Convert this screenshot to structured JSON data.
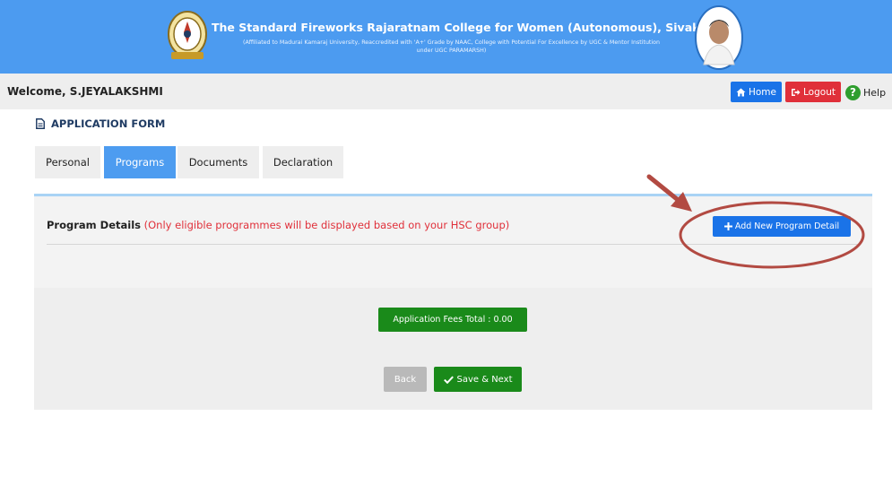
{
  "header": {
    "college_name": "The Standard Fireworks Rajaratnam College for Women (Autonomous), Sivakasi",
    "affiliation": "(Affiliated to Madurai Kamaraj University, Reaccredited with 'A+' Grade by NAAC, College with Potential For Excellence by UGC & Mentor Institution under UGC PARAMARSH)",
    "logo_icon": "college-emblem-icon",
    "portrait_icon": "founder-portrait"
  },
  "topbar": {
    "welcome": "Welcome, S.JEYALAKSHMI",
    "home_label": "Home",
    "logout_label": "Logout",
    "help_label": "Help",
    "home_icon": "home-icon",
    "logout_icon": "sign-out-icon",
    "help_icon": "question-circle-icon",
    "colors": {
      "home": "#1a73e8",
      "logout": "#e0303a",
      "help": "#2e9e2e"
    }
  },
  "form": {
    "heading": "APPLICATION FORM",
    "tabs": [
      {
        "label": "Personal",
        "active": false
      },
      {
        "label": "Programs",
        "active": true
      },
      {
        "label": "Documents",
        "active": false
      },
      {
        "label": "Declaration",
        "active": false
      }
    ],
    "program_details": {
      "title": "Program Details",
      "note": "(Only eligible programmes will be displayed based on your HSC group)",
      "add_button": "Add New Program Detail"
    },
    "fees_total": "Application Fees Total : 0.00",
    "back_label": "Back",
    "save_label": "Save & Next"
  },
  "colors": {
    "banner": "#4c9bf0",
    "active_tab": "#4d9cf0",
    "note_text": "#e0303a",
    "success": "#1a8a1a",
    "annotation": "#b24a42"
  }
}
